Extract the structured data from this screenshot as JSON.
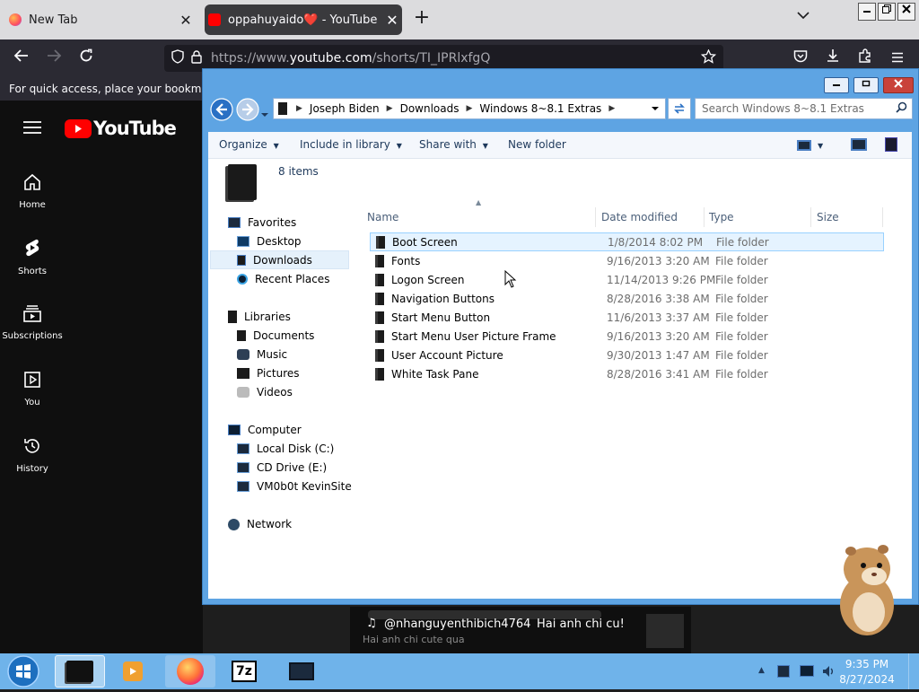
{
  "browser": {
    "tabs": [
      {
        "title": "New Tab",
        "close": "✕"
      },
      {
        "title": "oppahuyaido❤️ - YouTube",
        "close": "✕"
      }
    ],
    "new_tab": "+",
    "url_prefix": "https://www.",
    "url_host": "youtube.com",
    "url_path": "/shorts/TI_IPRlxfgQ",
    "bookmarks_hint": "For quick access, place your bookmarks here on the bookmarks toolbar."
  },
  "youtube": {
    "logo_text": "YouTube",
    "nav": [
      {
        "label": "Home",
        "icon": "home-icon"
      },
      {
        "label": "Shorts",
        "icon": "shorts-icon"
      },
      {
        "label": "Subscriptions",
        "icon": "subscriptions-icon"
      },
      {
        "label": "You",
        "icon": "you-icon"
      },
      {
        "label": "History",
        "icon": "history-icon"
      }
    ],
    "caption_user": "@nhanguyenthibich4764",
    "caption_text": "Hai anh chi cu!",
    "caption_sub": "Hai anh chi cute qua"
  },
  "explorer": {
    "breadcrumb": [
      "Joseph Biden",
      "Downloads",
      "Windows 8~8.1 Extras"
    ],
    "search_placeholder": "Search Windows 8~8.1 Extras",
    "commands": {
      "organize": "Organize",
      "include": "Include in library",
      "share": "Share with",
      "new_folder": "New folder"
    },
    "item_count": "8 items",
    "nav_pane": {
      "favorites": "Favorites",
      "desktop": "Desktop",
      "downloads": "Downloads",
      "recent": "Recent Places",
      "libraries": "Libraries",
      "documents": "Documents",
      "music": "Music",
      "pictures": "Pictures",
      "videos": "Videos",
      "computer": "Computer",
      "local_disk": "Local Disk (C:)",
      "cd_drive": "CD Drive (E:)",
      "vmbot": "VM0b0t KevinSite",
      "network": "Network"
    },
    "columns": {
      "name": "Name",
      "date": "Date modified",
      "type": "Type",
      "size": "Size"
    },
    "files": [
      {
        "name": "Boot Screen",
        "date": "1/8/2014 8:02 PM",
        "type": "File folder"
      },
      {
        "name": "Fonts",
        "date": "9/16/2013 3:20 AM",
        "type": "File folder"
      },
      {
        "name": "Logon Screen",
        "date": "11/14/2013 9:26 PM",
        "type": "File folder"
      },
      {
        "name": "Navigation Buttons",
        "date": "8/28/2016 3:38 AM",
        "type": "File folder"
      },
      {
        "name": "Start Menu Button",
        "date": "11/6/2013 3:37 AM",
        "type": "File folder"
      },
      {
        "name": "Start Menu User Picture Frame",
        "date": "9/16/2013 3:20 AM",
        "type": "File folder"
      },
      {
        "name": "User Account Picture",
        "date": "9/30/2013 1:47 AM",
        "type": "File folder"
      },
      {
        "name": "White Task Pane",
        "date": "8/28/2016 3:41 AM",
        "type": "File folder"
      }
    ]
  },
  "taskbar": {
    "time": "9:35 PM",
    "date": "8/27/2024",
    "zip_label": "7z"
  },
  "colors": {
    "win_frame": "#5ea4e3",
    "taskbar": "#6fb3ea",
    "youtube_red": "#ff0000",
    "firefox_dark": "#2b2a33",
    "selection": "#cce8ff"
  }
}
